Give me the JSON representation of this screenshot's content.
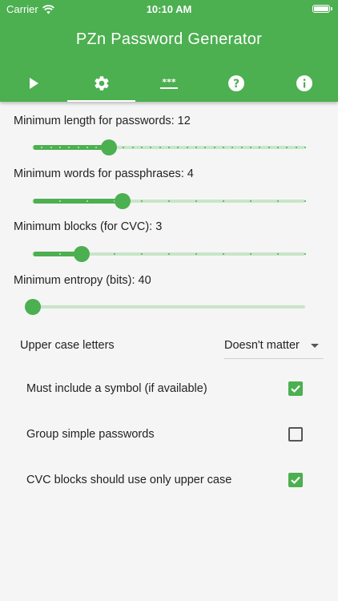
{
  "status_bar": {
    "carrier": "Carrier",
    "time": "10:10 AM"
  },
  "app_bar": {
    "title": "PZn Password Generator",
    "tabs": [
      {
        "icon": "play-icon",
        "active": false
      },
      {
        "icon": "gear-icon",
        "active": true
      },
      {
        "icon": "password-field-icon",
        "active": false
      },
      {
        "icon": "help-icon",
        "active": false
      },
      {
        "icon": "info-icon",
        "active": false
      }
    ]
  },
  "settings": {
    "sliders": [
      {
        "label": "Minimum length for passwords: 12",
        "fraction": 0.28,
        "ticks": 31
      },
      {
        "label": "Minimum words for passphrases: 4",
        "fraction": 0.33,
        "ticks": 11
      },
      {
        "label": "Minimum blocks (for CVC): 3",
        "fraction": 0.18,
        "ticks": 11
      },
      {
        "label": "Minimum  entropy (bits): 40",
        "fraction": 0.0,
        "ticks": 0
      }
    ],
    "uppercase": {
      "label": "Upper case letters",
      "selected": "Doesn't matter"
    },
    "checkboxes": [
      {
        "label": "Must include a symbol (if available)",
        "checked": true
      },
      {
        "label": "Group simple passwords",
        "checked": false
      },
      {
        "label": "CVC blocks should use only upper case",
        "checked": true
      }
    ]
  },
  "colors": {
    "accent": "#4caf50",
    "accent_light": "#c8e6c9"
  }
}
